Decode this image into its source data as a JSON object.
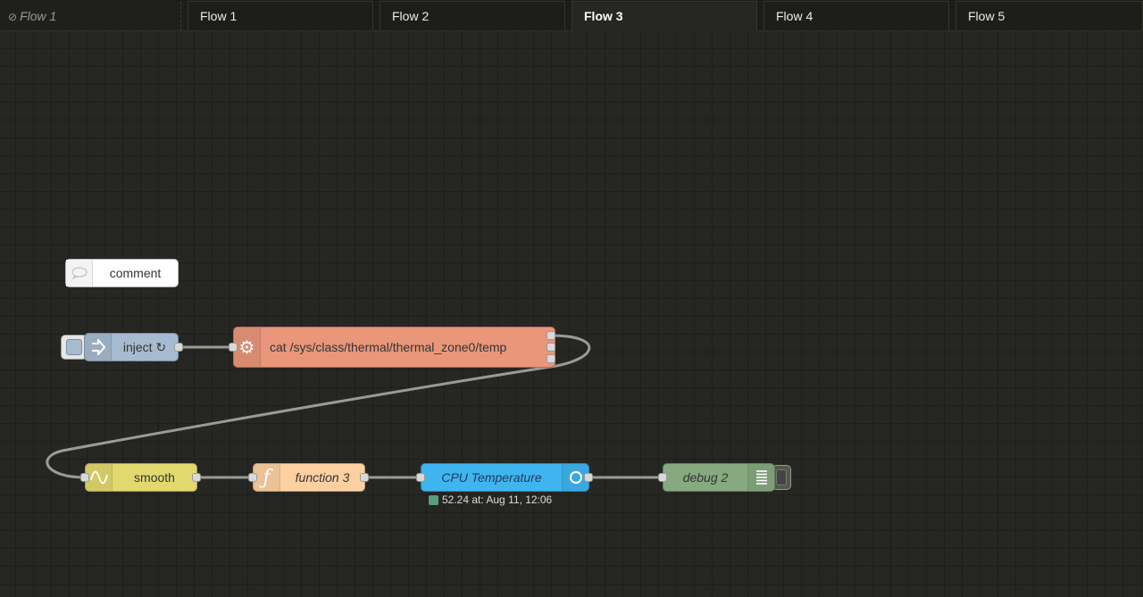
{
  "tabs": [
    {
      "label": "Flow 1",
      "state": "disabled",
      "icon": "ban-icon"
    },
    {
      "label": "Flow 1",
      "state": "normal"
    },
    {
      "label": "Flow 2",
      "state": "normal"
    },
    {
      "label": "Flow 3",
      "state": "active"
    },
    {
      "label": "Flow 4",
      "state": "normal"
    },
    {
      "label": "Flow 5",
      "state": "normal"
    }
  ],
  "nodes": {
    "comment": {
      "label": "comment",
      "icon": "comment-icon",
      "color": "#ffffff"
    },
    "inject": {
      "label": "inject ↻",
      "icon": "arrow-in-icon",
      "color": "#a6bbcf"
    },
    "exec": {
      "label": "cat /sys/class/thermal/thermal_zone0/temp",
      "icon": "gear-icon",
      "color": "#e9967a"
    },
    "smooth": {
      "label": "smooth",
      "icon": "wave-icon",
      "color": "#e2d96e"
    },
    "function": {
      "label": "function 3",
      "icon": "function-icon",
      "color": "#fdd0a2"
    },
    "gauge": {
      "label": "CPU Temperature",
      "icon": "circle-icon",
      "color": "#3fadb5",
      "status": "52.24 at: Aug 11, 12:06",
      "status_color": "#5a9c7a"
    },
    "debug": {
      "label": "debug 2",
      "icon": "list-icon",
      "color": "#87a980"
    }
  }
}
